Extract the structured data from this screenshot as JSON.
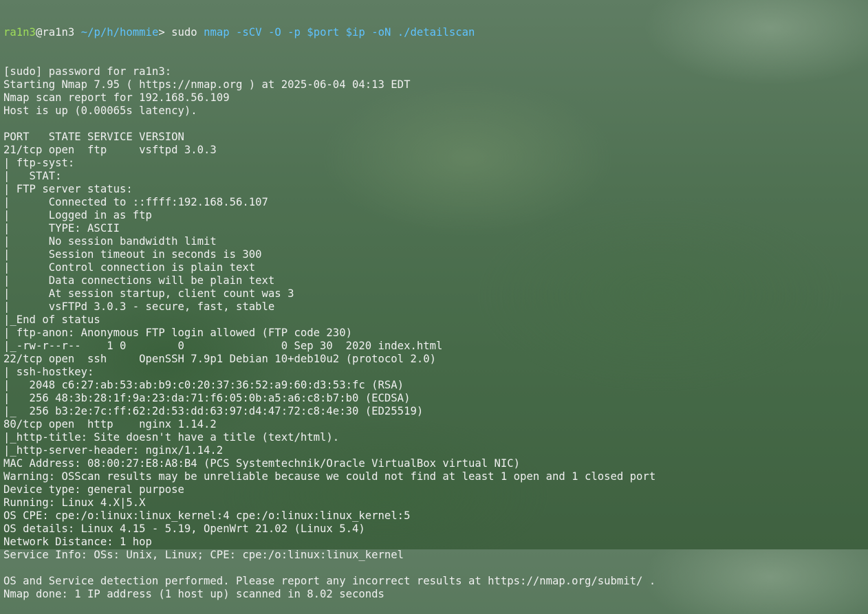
{
  "prompt": {
    "user_host": "ra1n3",
    "at": "@",
    "host": "ra1n3",
    "path": "~/p/h/hommie",
    "symbol": ">",
    "command_name": "sudo",
    "command_args": "nmap -sCV -O -p $port $ip -oN ./detailscan"
  },
  "output_lines": [
    "[sudo] password for ra1n3:",
    "Starting Nmap 7.95 ( https://nmap.org ) at 2025-06-04 04:13 EDT",
    "Nmap scan report for 192.168.56.109",
    "Host is up (0.00065s latency).",
    "",
    "PORT   STATE SERVICE VERSION",
    "21/tcp open  ftp     vsftpd 3.0.3",
    "| ftp-syst:",
    "|   STAT:",
    "| FTP server status:",
    "|      Connected to ::ffff:192.168.56.107",
    "|      Logged in as ftp",
    "|      TYPE: ASCII",
    "|      No session bandwidth limit",
    "|      Session timeout in seconds is 300",
    "|      Control connection is plain text",
    "|      Data connections will be plain text",
    "|      At session startup, client count was 3",
    "|      vsFTPd 3.0.3 - secure, fast, stable",
    "|_End of status",
    "| ftp-anon: Anonymous FTP login allowed (FTP code 230)",
    "|_-rw-r--r--    1 0        0               0 Sep 30  2020 index.html",
    "22/tcp open  ssh     OpenSSH 7.9p1 Debian 10+deb10u2 (protocol 2.0)",
    "| ssh-hostkey:",
    "|   2048 c6:27:ab:53:ab:b9:c0:20:37:36:52:a9:60:d3:53:fc (RSA)",
    "|   256 48:3b:28:1f:9a:23:da:71:f6:05:0b:a5:a6:c8:b7:b0 (ECDSA)",
    "|_  256 b3:2e:7c:ff:62:2d:53:dd:63:97:d4:47:72:c8:4e:30 (ED25519)",
    "80/tcp open  http    nginx 1.14.2",
    "|_http-title: Site doesn't have a title (text/html).",
    "|_http-server-header: nginx/1.14.2",
    "MAC Address: 08:00:27:E8:A8:B4 (PCS Systemtechnik/Oracle VirtualBox virtual NIC)",
    "Warning: OSScan results may be unreliable because we could not find at least 1 open and 1 closed port",
    "Device type: general purpose",
    "Running: Linux 4.X|5.X",
    "OS CPE: cpe:/o:linux:linux_kernel:4 cpe:/o:linux:linux_kernel:5",
    "OS details: Linux 4.15 - 5.19, OpenWrt 21.02 (Linux 5.4)",
    "Network Distance: 1 hop",
    "Service Info: OSs: Unix, Linux; CPE: cpe:/o:linux:linux_kernel",
    "",
    "OS and Service detection performed. Please report any incorrect results at https://nmap.org/submit/ .",
    "Nmap done: 1 IP address (1 host up) scanned in 8.02 seconds"
  ],
  "colors": {
    "text": "#f0f0f0",
    "prompt_user": "#9fdd5a",
    "prompt_path": "#5fc2ff",
    "command_args": "#5fc2ff",
    "background": "#4f7152"
  }
}
